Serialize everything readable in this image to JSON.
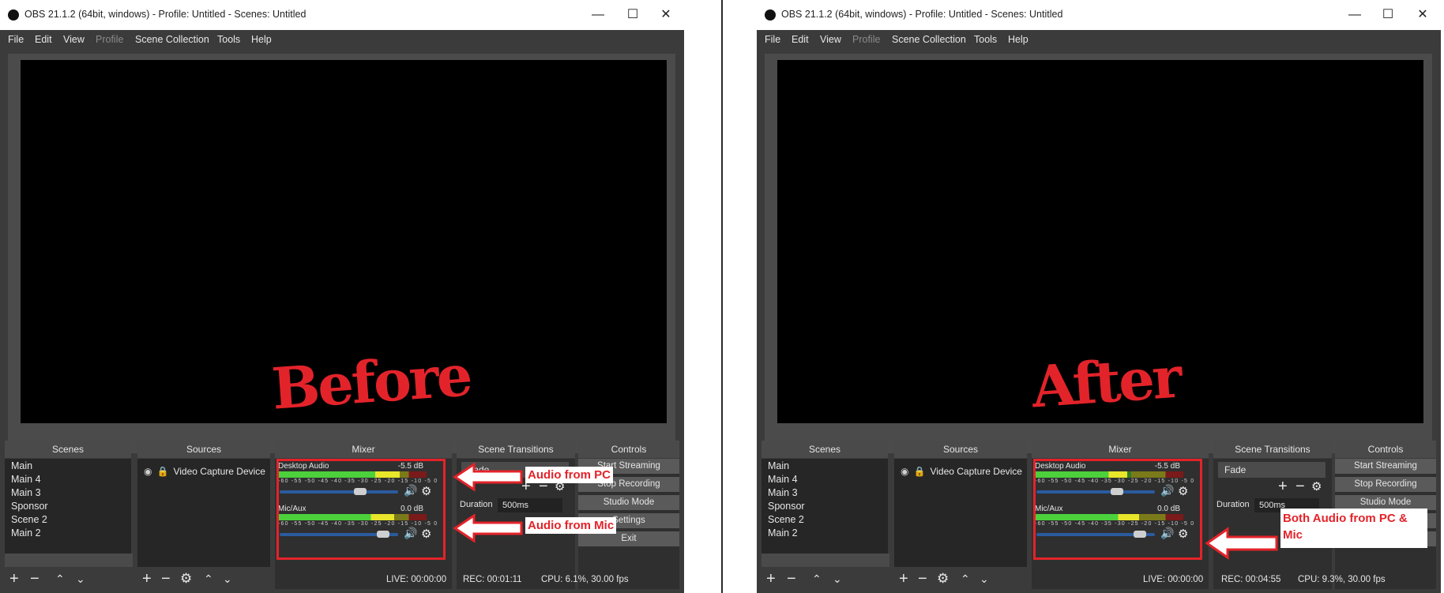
{
  "window": {
    "title": "OBS 21.1.2 (64bit, windows) - Profile: Untitled - Scenes: Untitled",
    "min_glyph": "—",
    "max_glyph": "☐",
    "close_glyph": "✕"
  },
  "menu": [
    "File",
    "Edit",
    "View",
    "Profile",
    "Scene Collection",
    "Tools",
    "Help"
  ],
  "docks": {
    "scenes": "Scenes",
    "sources": "Sources",
    "mixer": "Mixer",
    "transitions": "Scene Transitions",
    "controls": "Controls"
  },
  "scenes": [
    "Main",
    "Main 4",
    "Main 3",
    "Sponsor",
    "Scene 2",
    "Main 2"
  ],
  "selected_scene": "Main 2",
  "source": "Video Capture Device",
  "tracks": {
    "desktop": "Desktop Audio",
    "mic": "Mic/Aux"
  },
  "meter_ticks": "-60 -55 -50 -45 -40 -35 -30 -25 -20 -15 -10 -5 0",
  "transition": {
    "duration_label": "Duration",
    "duration_value": "500ms"
  },
  "before": {
    "annotation": "Before",
    "desktop_db": "-5.5 dB",
    "mic_db": "0.0 dB",
    "desktop_meter_level": 0.82,
    "mic_meter_level": 0.78,
    "desktop_volume": 0.7,
    "mic_volume": 0.92,
    "transition_select": "Fade",
    "controls": [
      "Start Streaming",
      "Stop Recording",
      "Studio Mode",
      "Settings",
      "Exit"
    ],
    "status": {
      "live": "LIVE: 00:00:00",
      "rec": "REC: 00:01:11",
      "cpu": "CPU: 6.1%, 30.00 fps"
    },
    "callout_pc": "Audio from PC",
    "callout_mic": "Audio from Mic"
  },
  "after": {
    "annotation": "After",
    "desktop_db": "-5.5 dB",
    "mic_db": "0.0 dB",
    "desktop_meter_level": 0.62,
    "mic_meter_level": 0.7,
    "desktop_volume": 0.7,
    "mic_volume": 0.92,
    "transition_select": "Fade",
    "controls": [
      "Start Streaming",
      "Stop Recording",
      "Studio Mode"
    ],
    "status": {
      "live": "LIVE: 00:00:00",
      "rec": "REC: 00:04:55",
      "cpu": "CPU: 9.3%, 30.00 fps"
    },
    "callout_both": "Both Audio from PC &\nMic"
  },
  "colors": {
    "annotation_red": "#e3232a",
    "meter_green": "#4cd13c",
    "meter_yellow": "#e8e52a",
    "slider_blue": "#2a5b9e"
  }
}
